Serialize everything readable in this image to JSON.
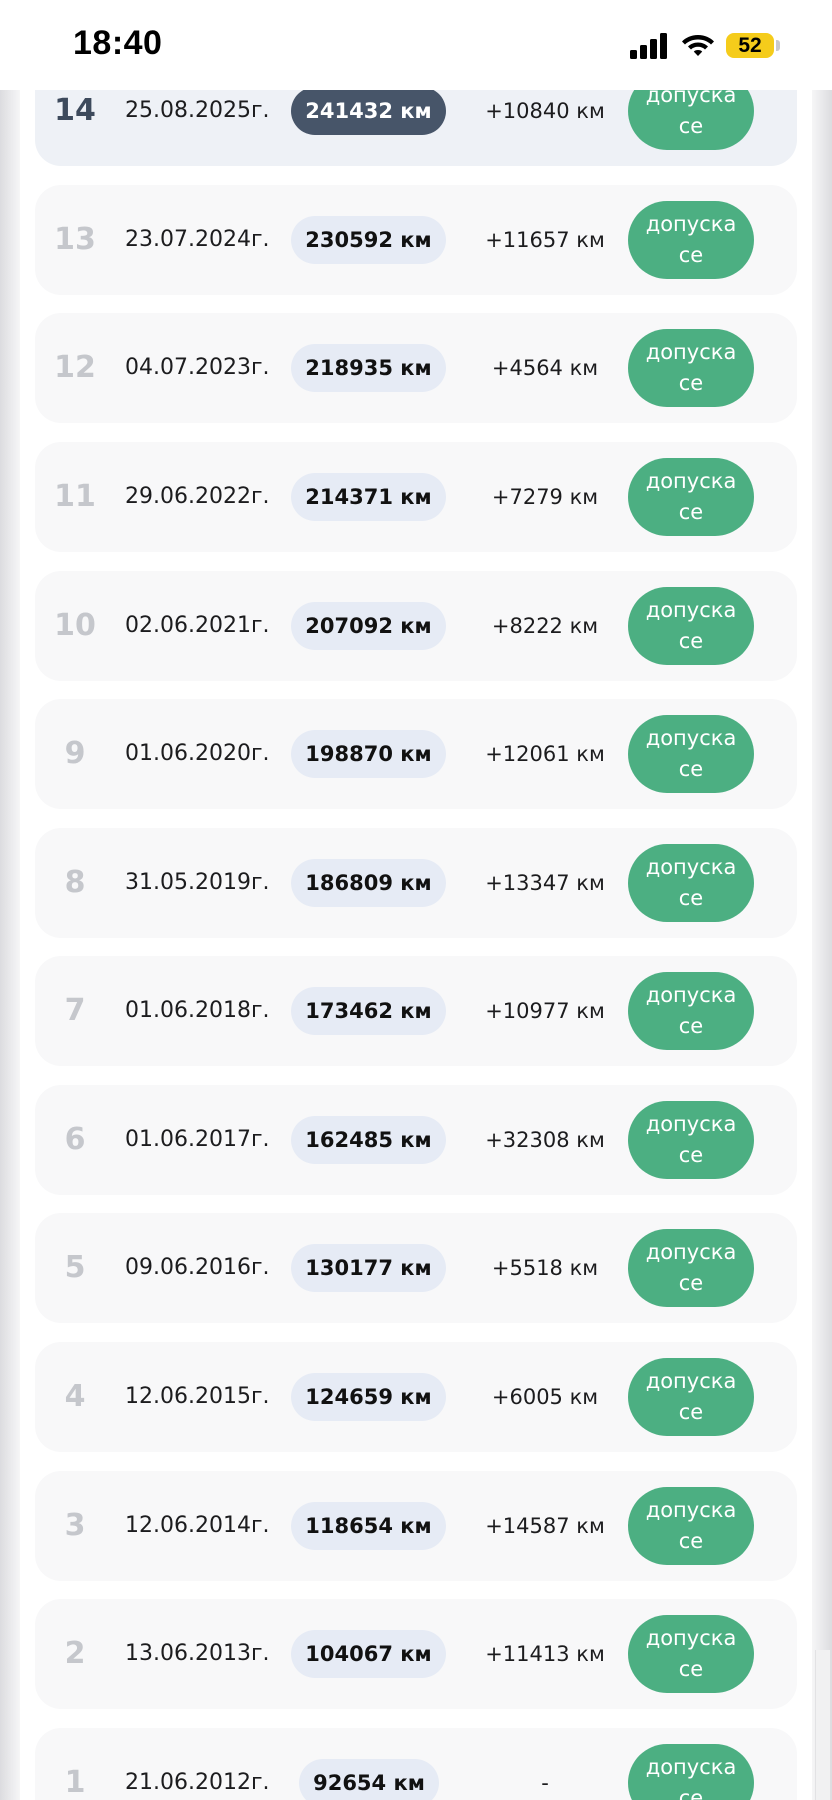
{
  "status_bar": {
    "time": "18:40",
    "battery": "52"
  },
  "rows": [
    {
      "index": "14",
      "date": "25.08.2025г.",
      "km": "241432 км",
      "diff": "+10840 км",
      "status": "допуска се"
    },
    {
      "index": "13",
      "date": "23.07.2024г.",
      "km": "230592 км",
      "diff": "+11657 км",
      "status": "допуска се"
    },
    {
      "index": "12",
      "date": "04.07.2023г.",
      "km": "218935 км",
      "diff": "+4564 км",
      "status": "допуска се"
    },
    {
      "index": "11",
      "date": "29.06.2022г.",
      "km": "214371 км",
      "diff": "+7279 км",
      "status": "допуска се"
    },
    {
      "index": "10",
      "date": "02.06.2021г.",
      "km": "207092 км",
      "diff": "+8222 км",
      "status": "допуска се"
    },
    {
      "index": "9",
      "date": "01.06.2020г.",
      "km": "198870 км",
      "diff": "+12061 км",
      "status": "допуска се"
    },
    {
      "index": "8",
      "date": "31.05.2019г.",
      "km": "186809 км",
      "diff": "+13347 км",
      "status": "допуска се"
    },
    {
      "index": "7",
      "date": "01.06.2018г.",
      "km": "173462 км",
      "diff": "+10977 км",
      "status": "допуска се"
    },
    {
      "index": "6",
      "date": "01.06.2017г.",
      "km": "162485 км",
      "diff": "+32308 км",
      "status": "допуска се"
    },
    {
      "index": "5",
      "date": "09.06.2016г.",
      "km": "130177 км",
      "diff": "+5518 км",
      "status": "допуска се"
    },
    {
      "index": "4",
      "date": "12.06.2015г.",
      "km": "124659 км",
      "diff": "+6005 км",
      "status": "допуска се"
    },
    {
      "index": "3",
      "date": "12.06.2014г.",
      "km": "118654 км",
      "diff": "+14587 км",
      "status": "допуска се"
    },
    {
      "index": "2",
      "date": "13.06.2013г.",
      "km": "104067 км",
      "diff": "+11413 км",
      "status": "допуска се"
    },
    {
      "index": "1",
      "date": "21.06.2012г.",
      "km": "92654 км",
      "diff": "-",
      "status": "допуска се"
    }
  ],
  "colors": {
    "status_green": "#4caf82",
    "current_km_badge": "#475569",
    "km_badge": "#e6ebf5",
    "battery": "#f5cc1b"
  },
  "icons": {
    "signal": "cellular-signal-icon",
    "wifi": "wifi-icon"
  }
}
